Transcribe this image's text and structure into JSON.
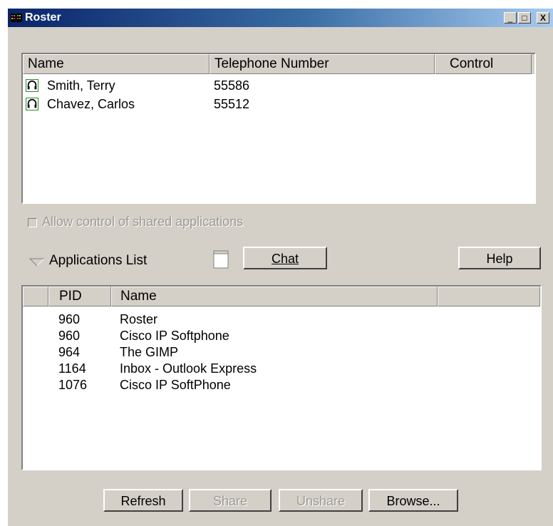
{
  "window": {
    "title": "Roster",
    "minimize": "_",
    "maximize": "□",
    "close": "X"
  },
  "roster": {
    "columns": [
      "Name",
      "Telephone Number",
      "Control"
    ],
    "rows": [
      {
        "name": "Smith, Terry",
        "phone": "55586",
        "control": "",
        "icon": "headset-icon"
      },
      {
        "name": "Chavez, Carlos",
        "phone": "55512",
        "control": "",
        "icon": "headset-icon"
      }
    ]
  },
  "allow_control": {
    "label": "Allow control of shared applications",
    "checked": false,
    "enabled": false
  },
  "apps_list_label": "Applications List",
  "chat_button": "Chat",
  "help_button": "Help",
  "applications": {
    "columns": [
      "",
      "PID",
      "Name",
      ""
    ],
    "rows": [
      {
        "pid": "960",
        "name": "Roster"
      },
      {
        "pid": "960",
        "name": "Cisco IP Softphone"
      },
      {
        "pid": "964",
        "name": "The GIMP"
      },
      {
        "pid": "1164",
        "name": "Inbox - Outlook Express"
      },
      {
        "pid": "1076",
        "name": "Cisco IP SoftPhone"
      }
    ]
  },
  "buttons": {
    "refresh": "Refresh",
    "share": "Share",
    "unshare": "Unshare",
    "browse": "Browse..."
  },
  "colors": {
    "face": "#d4d0c8",
    "title_start": "#0a246a",
    "title_end": "#a6caf0",
    "disabled_text": "#9c9a94",
    "headset_border": "#2a8a2a"
  }
}
